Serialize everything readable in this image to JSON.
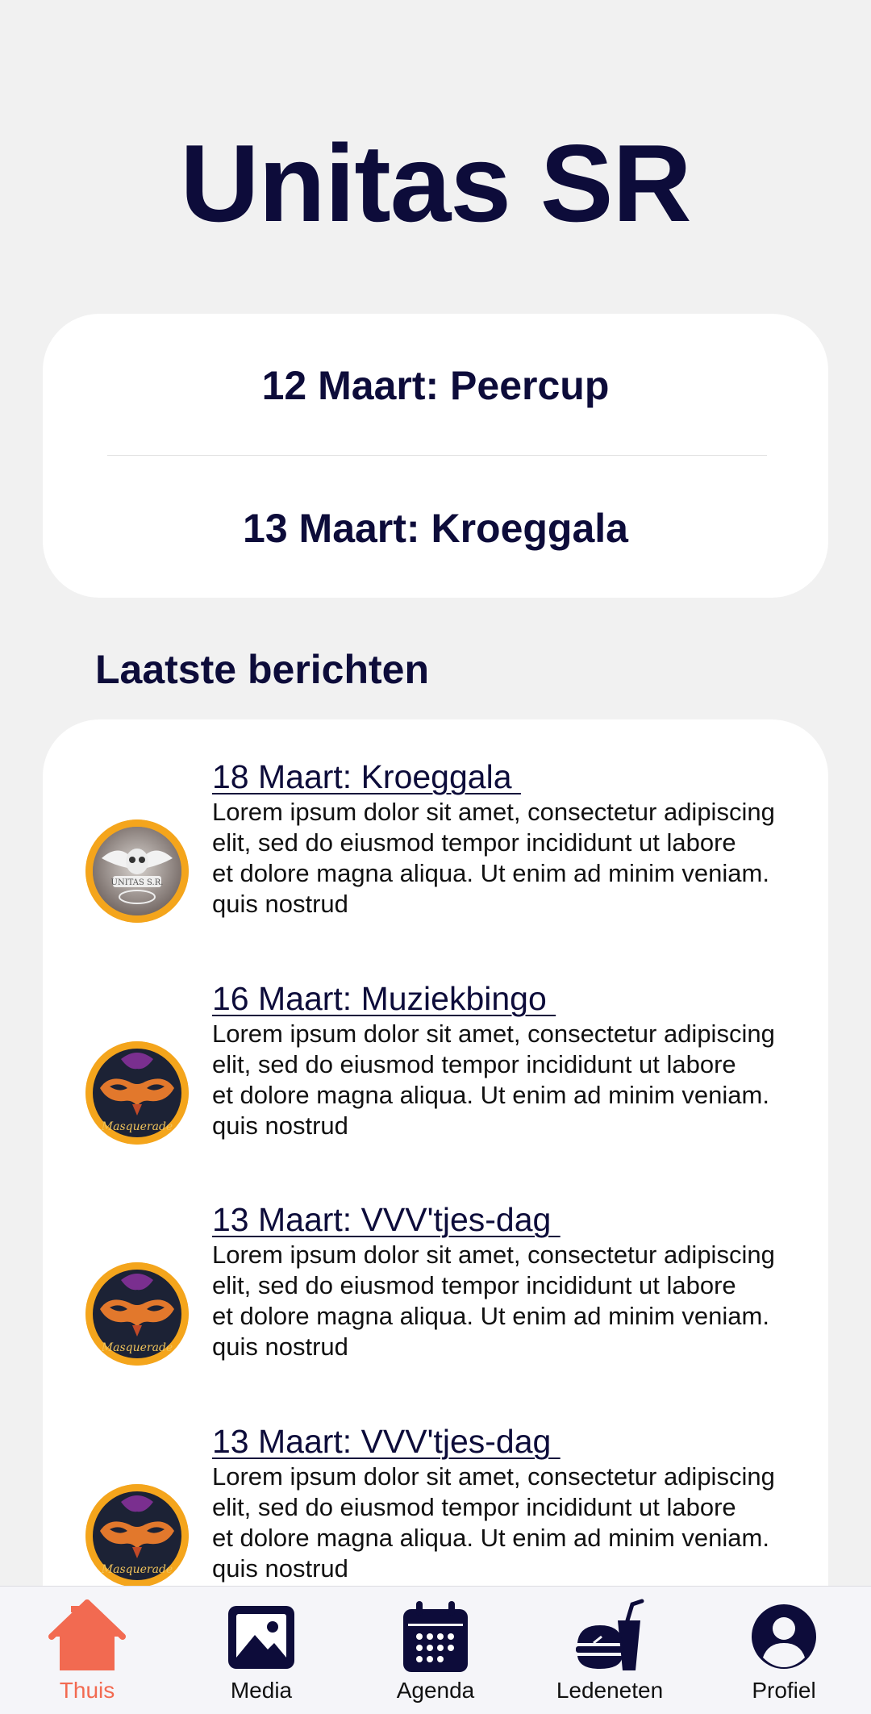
{
  "app": {
    "title": "Unitas SR"
  },
  "upcoming": {
    "items": [
      {
        "label": "12 Maart: Peercup"
      },
      {
        "label": "13 Maart: Kroeggala"
      }
    ]
  },
  "news": {
    "heading": "Laatste berichten",
    "items": [
      {
        "title": "18 Maart: Kroeggala ",
        "image": "owl-logo",
        "lines": [
          "Lorem ipsum dolor sit amet, consectetur adipiscing",
          "elit, sed do eiusmod tempor incididunt ut labore",
          "et dolore magna aliqua. Ut enim ad minim veniam.",
          "quis nostrud"
        ]
      },
      {
        "title": "16 Maart: Muziekbingo ",
        "image": "masquerade-mask",
        "lines": [
          "Lorem ipsum dolor sit amet, consectetur adipiscing",
          "elit, sed do eiusmod tempor incididunt ut labore",
          "et dolore magna aliqua. Ut enim ad minim veniam.",
          "quis nostrud"
        ]
      },
      {
        "title": "13 Maart: VVV'tjes-dag ",
        "image": "masquerade-mask",
        "lines": [
          "Lorem ipsum dolor sit amet, consectetur adipiscing",
          "elit, sed do eiusmod tempor incididunt ut labore",
          "et dolore magna aliqua. Ut enim ad minim veniam.",
          "quis nostrud"
        ]
      },
      {
        "title": "13 Maart: VVV'tjes-dag ",
        "image": "masquerade-mask",
        "lines": [
          "Lorem ipsum dolor sit amet, consectetur adipiscing",
          "elit, sed do eiusmod tempor incididunt ut labore",
          "et dolore magna aliqua. Ut enim ad minim veniam.",
          "quis nostrud"
        ]
      }
    ]
  },
  "nav": {
    "items": [
      {
        "label": "Thuis",
        "icon": "home-icon",
        "active": true
      },
      {
        "label": "Media",
        "icon": "image-icon",
        "active": false
      },
      {
        "label": "Agenda",
        "icon": "calendar-icon",
        "active": false
      },
      {
        "label": "Ledeneten",
        "icon": "fast-food-icon",
        "active": false
      },
      {
        "label": "Profiel",
        "icon": "profile-icon",
        "active": false
      }
    ]
  },
  "colors": {
    "navy": "#0d0c3a",
    "accent": "#f26a51",
    "avatar_ring": "#f4a51c",
    "background": "#f1f1f1",
    "card": "#ffffff"
  }
}
